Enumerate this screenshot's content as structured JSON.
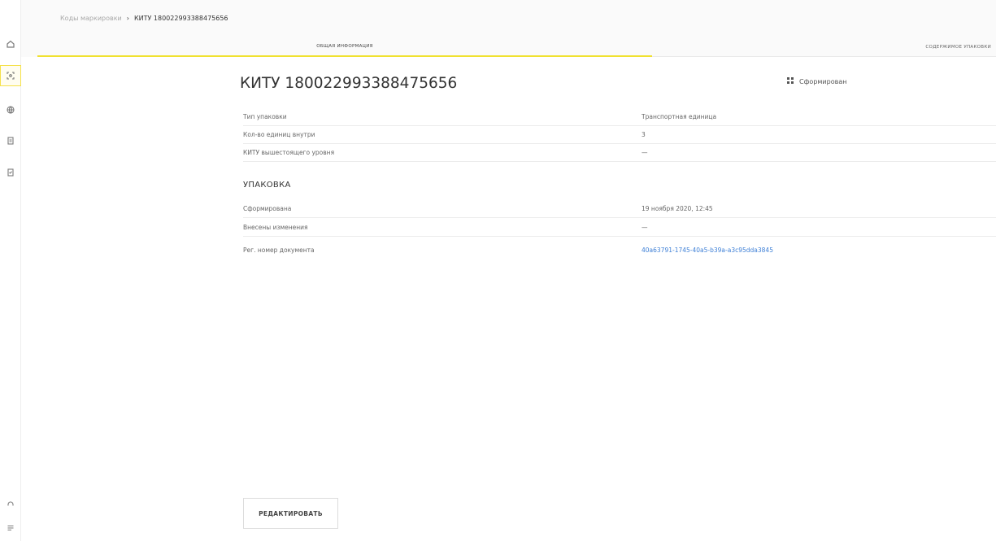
{
  "breadcrumb": {
    "parent": "Коды маркировки",
    "separator": "›",
    "current": "КИТУ 180022993388475656"
  },
  "tabs": [
    {
      "label": "ОБЩАЯ ИНФОРМАЦИЯ",
      "active": true
    },
    {
      "label": "СОДЕРЖИМОЕ УПАКОВКИ",
      "active": false
    }
  ],
  "header": {
    "title": "КИТУ 180022993388475656",
    "status": "Сформирован"
  },
  "general_rows": [
    {
      "label": "Тип упаковки",
      "value": "Транспортная единица"
    },
    {
      "label": "Кол-во единиц внутри",
      "value": "3"
    },
    {
      "label": "КИТУ вышестоящего уровня",
      "value": "—"
    }
  ],
  "packaging": {
    "title": "УПАКОВКА",
    "rows": [
      {
        "label": "Сформирована",
        "value": "19 ноября 2020, 12:45"
      },
      {
        "label": "Внесены изменения",
        "value": "—"
      },
      {
        "label": "Рег. номер документа",
        "value": "40a63791-1745-40a5-b39a-a3c95dda3845"
      }
    ]
  },
  "actions": {
    "edit_label": "РЕДАКТИРОВАТЬ"
  },
  "colors": {
    "accent": "#f0e130",
    "link": "#3d7fd6"
  },
  "icons": {
    "sidebar": [
      "home-icon",
      "codes-icon",
      "globe-icon",
      "document-icon",
      "checklist-icon",
      "support-icon",
      "menu-icon"
    ],
    "status": "grid-icon"
  }
}
